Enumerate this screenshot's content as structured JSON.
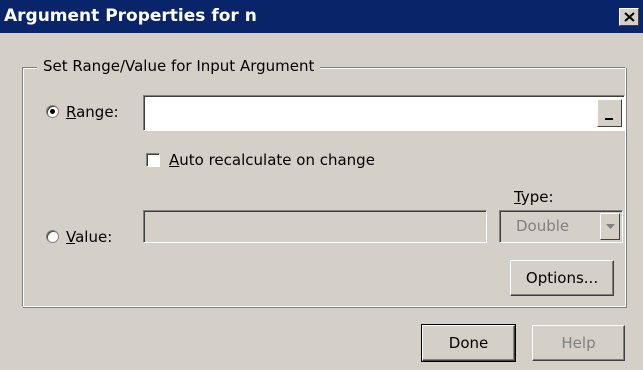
{
  "window": {
    "title": "Argument Properties for n",
    "close_glyph": "✕"
  },
  "group": {
    "legend": "Set Range/Value for Input Argument"
  },
  "range": {
    "label_mnemonic": "R",
    "label_rest": "ange:",
    "selected": true,
    "value": "",
    "button_label": "_"
  },
  "auto_recalc": {
    "label_mnemonic": "A",
    "label_rest": "uto recalculate on change",
    "checked": false
  },
  "value": {
    "label_mnemonic": "V",
    "label_rest": "alue:",
    "selected": false,
    "value": ""
  },
  "type": {
    "label_mnemonic": "T",
    "label_rest": "ype:",
    "selected": "Double"
  },
  "buttons": {
    "options": "Options...",
    "done": "Done",
    "help": "Help"
  },
  "icons": {
    "close": "close-icon",
    "dropdown": "chevron-down-icon",
    "range_picker": "range-picker-icon"
  }
}
